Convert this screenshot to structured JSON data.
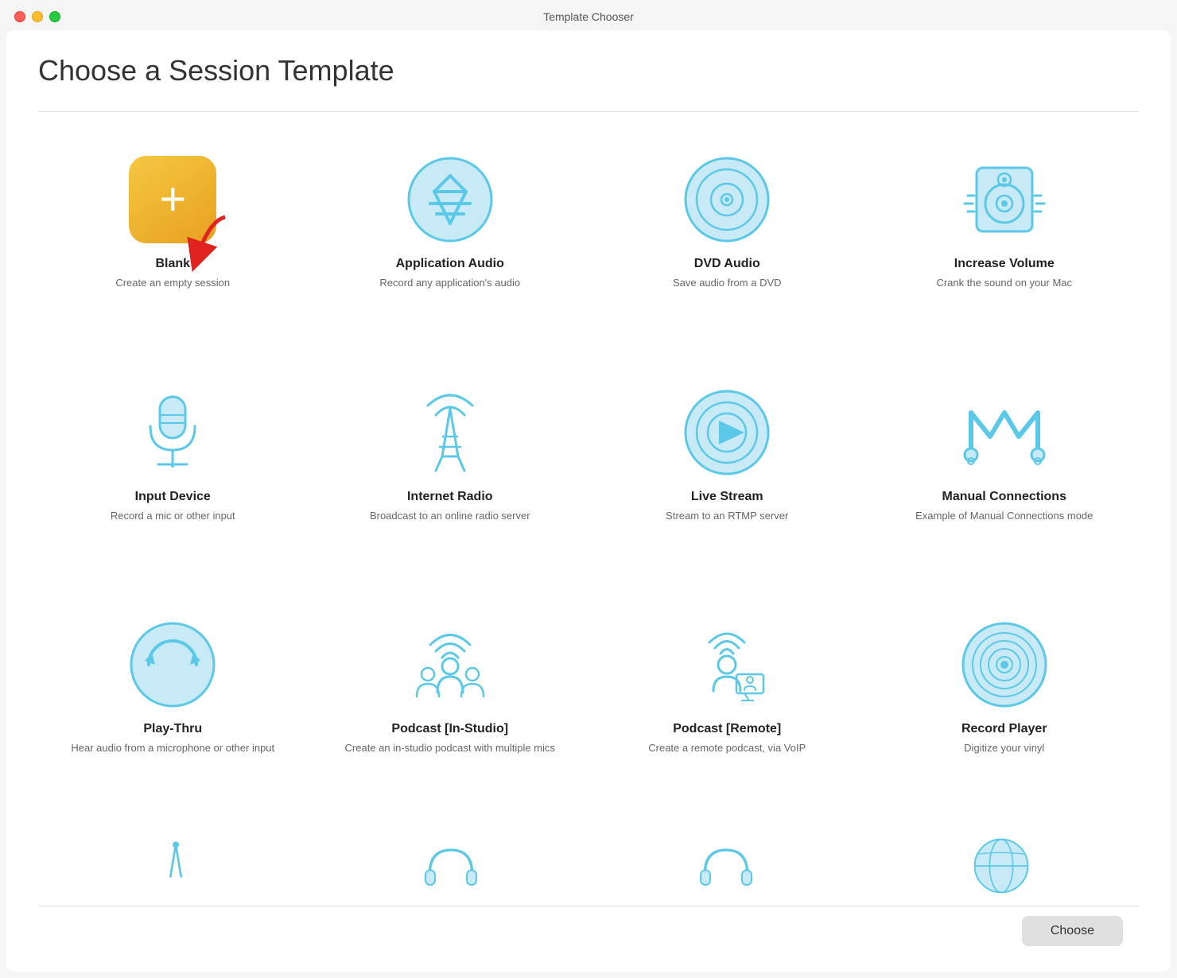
{
  "window": {
    "title": "Template Chooser"
  },
  "page": {
    "heading": "Choose a Session Template",
    "choose_button": "Choose"
  },
  "templates": [
    {
      "id": "blank",
      "name": "Blank",
      "desc": "Create an empty session",
      "icon_type": "blank"
    },
    {
      "id": "application-audio",
      "name": "Application Audio",
      "desc": "Record any application's audio",
      "icon_type": "application"
    },
    {
      "id": "dvd-audio",
      "name": "DVD Audio",
      "desc": "Save audio from a DVD",
      "icon_type": "dvd"
    },
    {
      "id": "increase-volume",
      "name": "Increase Volume",
      "desc": "Crank the sound on your Mac",
      "icon_type": "speaker"
    },
    {
      "id": "input-device",
      "name": "Input Device",
      "desc": "Record a mic or other input",
      "icon_type": "mic"
    },
    {
      "id": "internet-radio",
      "name": "Internet Radio",
      "desc": "Broadcast to an online radio server",
      "icon_type": "radio"
    },
    {
      "id": "live-stream",
      "name": "Live Stream",
      "desc": "Stream to an RTMP server",
      "icon_type": "stream"
    },
    {
      "id": "manual-connections",
      "name": "Manual Connections",
      "desc": "Example of Manual Connections mode",
      "icon_type": "manual"
    },
    {
      "id": "play-thru",
      "name": "Play-Thru",
      "desc": "Hear audio from a microphone or other input",
      "icon_type": "playthru"
    },
    {
      "id": "podcast-in-studio",
      "name": "Podcast [In-Studio]",
      "desc": "Create an in-studio podcast with multiple mics",
      "icon_type": "podcast-studio"
    },
    {
      "id": "podcast-remote",
      "name": "Podcast [Remote]",
      "desc": "Create a remote podcast, via VoIP",
      "icon_type": "podcast-remote"
    },
    {
      "id": "record-player",
      "name": "Record Player",
      "desc": "Digitize your vinyl",
      "icon_type": "vinyl"
    }
  ],
  "partial_row": [
    {
      "id": "partial1",
      "icon_type": "partial-arrow"
    },
    {
      "id": "partial2",
      "icon_type": "partial-headphones"
    },
    {
      "id": "partial3",
      "icon_type": "partial-unknown"
    },
    {
      "id": "partial4",
      "icon_type": "partial-globe"
    }
  ]
}
